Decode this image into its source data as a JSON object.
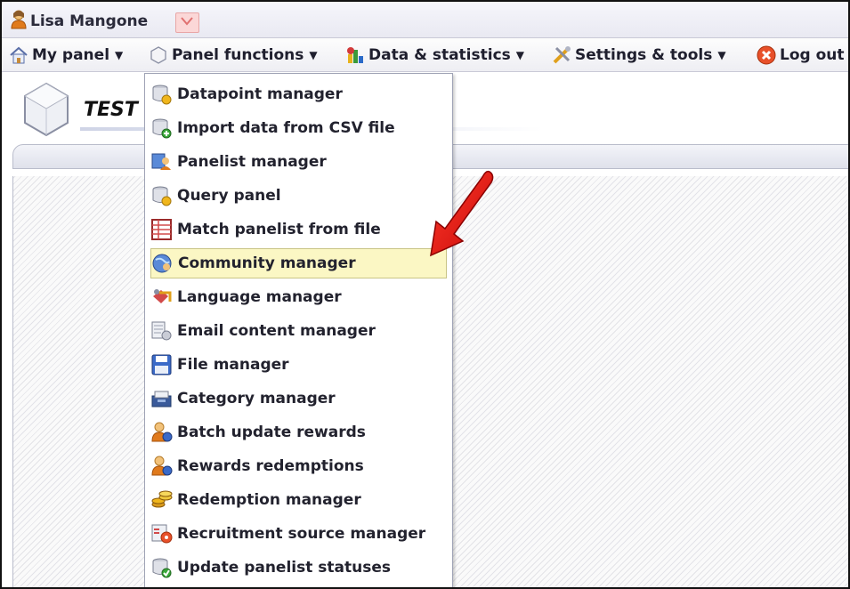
{
  "userbar": {
    "user_name": "Lisa Mangone"
  },
  "menubar": {
    "items": [
      {
        "label": "My panel",
        "icon": "home-icon"
      },
      {
        "label": "Panel functions",
        "icon": "cube-icon"
      },
      {
        "label": "Data & statistics",
        "icon": "statistics-icon"
      },
      {
        "label": "Settings & tools",
        "icon": "tools-icon"
      },
      {
        "label": "Log out",
        "icon": "logout-icon"
      }
    ]
  },
  "header": {
    "title": "TEST"
  },
  "dropdown": {
    "items": [
      {
        "label": "Datapoint manager",
        "icon": "database-icon"
      },
      {
        "label": "Import data from CSV file",
        "icon": "database-import-icon"
      },
      {
        "label": "Panelist manager",
        "icon": "panelist-icon"
      },
      {
        "label": "Query panel",
        "icon": "query-icon"
      },
      {
        "label": "Match panelist from file",
        "icon": "table-icon"
      },
      {
        "label": "Community manager",
        "icon": "community-icon"
      },
      {
        "label": "Language manager",
        "icon": "language-icon"
      },
      {
        "label": "Email content manager",
        "icon": "email-icon"
      },
      {
        "label": "File manager",
        "icon": "floppy-icon"
      },
      {
        "label": "Category manager",
        "icon": "category-icon"
      },
      {
        "label": "Batch update rewards",
        "icon": "user-reward-icon"
      },
      {
        "label": "Rewards redemptions",
        "icon": "user-redeem-icon"
      },
      {
        "label": "Redemption manager",
        "icon": "coins-icon"
      },
      {
        "label": "Recruitment source manager",
        "icon": "recruitment-icon"
      },
      {
        "label": "Update panelist statuses",
        "icon": "update-status-icon"
      }
    ],
    "active_item": "Community manager"
  },
  "colors": {
    "highlight": "#fbf7c4",
    "arrow": "#e01010",
    "menubar": "#eeeef3"
  }
}
